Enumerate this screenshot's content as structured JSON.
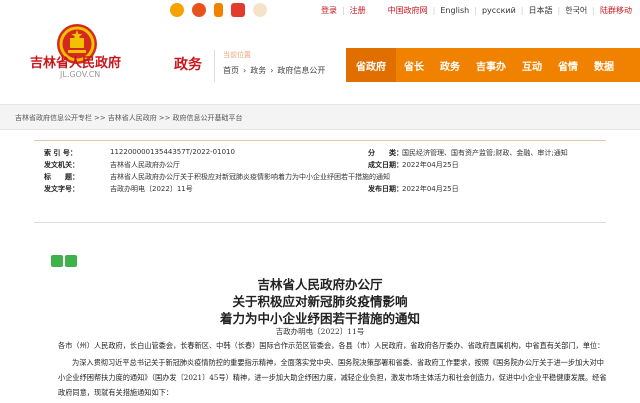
{
  "topbar": {
    "login": "登录",
    "register": "注册",
    "gov_net": "中国政府网",
    "lang_en": "English",
    "lang_ru": "русский",
    "lang_ja": "日本語",
    "lang_ko": "한국어",
    "care": "陆群移动",
    "share_icons": [
      "weixin-icon",
      "weibo-icon",
      "phone-icon",
      "app-icon",
      "mascot-icon"
    ]
  },
  "header": {
    "site_title": "吉林省人民政府",
    "site_domain": "JL.GOV.CN",
    "channel": "政务",
    "crumb_label": "当前位置",
    "crumbs": [
      "首页",
      "政务",
      "政府信息公开"
    ],
    "nav": [
      "省政府",
      "省长",
      "政务",
      "吉事办",
      "互动",
      "省情",
      "数据"
    ]
  },
  "band": {
    "crumbs": [
      "吉林省政府信息公开专栏",
      "吉林省人民政府",
      "政府信息公开基础平台"
    ]
  },
  "meta": {
    "rows": [
      {
        "l1": "索 引 号：",
        "v1": "11220000013544357T/2022-01010",
        "l2": "分　　类：",
        "v2": "国民经济管理、国有资产监管;财政、金融、审计;通知"
      },
      {
        "l1": "发文机关：",
        "v1": "吉林省人民政府办公厅",
        "l2": "成文日期：",
        "v2": "2022年04月25日"
      },
      {
        "l1": "标　　题：",
        "v1": "吉林省人民政府办公厅关于积极应对新冠肺炎疫情影响着力为中小企业纾困若干措施的通知",
        "l2": "",
        "v2": ""
      },
      {
        "l1": "发文字号：",
        "v1": "吉政办明电〔2022〕11号",
        "l2": "发布日期：",
        "v2": "2022年04月25日"
      }
    ]
  },
  "article": {
    "title_line1": "吉林省人民政府办公厅",
    "title_line2": "关于积极应对新冠肺炎疫情影响",
    "title_line3": "着力为中小企业纾困若干措施的通知",
    "doc_number": "吉政办明电〔2022〕11号",
    "para1": "各市（州）人民政府，长白山管委会，长春新区、中韩（长春）国际合作示范区管委会，各县（市）人民政府，省政府各厅委办、省政府直属机构，中省直有关部门，单位：",
    "para2": "为深入贯彻习近平总书记关于新冠肺炎疫情防控的重要指示精神，全面落实党中央、国务院决策部署和省委、省政府工作要求，按照《国务院办公厅关于进一步加大对中小企业纾困帮扶力度的通知》（国办发〔2021〕45号）精神，进一步加大助企纾困力度，减轻企业负担，激发市场主体活力和社会创造力，促进中小企业平稳健康发展。经省政府同意，现就有关措施通知如下："
  },
  "colors": {
    "brand_red": "#c8161d",
    "nav_orange": "#f08200"
  }
}
